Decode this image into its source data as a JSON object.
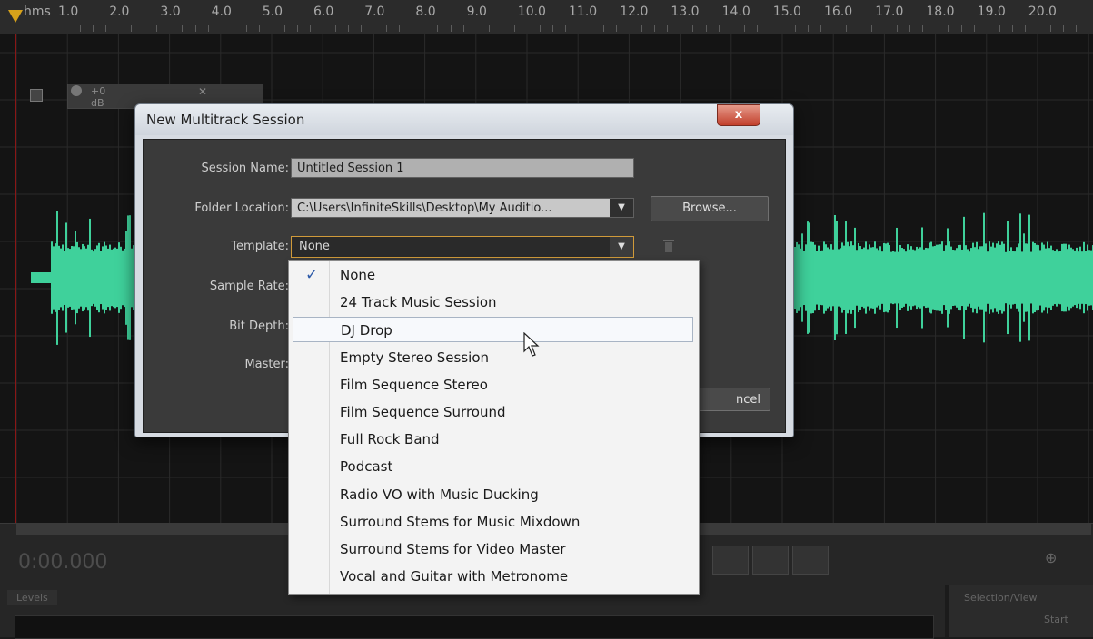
{
  "ruler": {
    "unit": "hms",
    "labels": [
      "1.0",
      "2.0",
      "3.0",
      "4.0",
      "5.0",
      "6.0",
      "7.0",
      "8.0",
      "9.0",
      "10.0",
      "11.0",
      "12.0",
      "13.0",
      "14.0",
      "15.0",
      "16.0",
      "17.0",
      "18.0",
      "19.0",
      "20.0"
    ]
  },
  "track": {
    "volume": "+0 dB"
  },
  "transport": {
    "timecode": "0:00.000"
  },
  "panels": {
    "levels_tab": "Levels",
    "selection_title": "Selection/View",
    "selection_start": "Start"
  },
  "dialog": {
    "title": "New Multitrack Session",
    "close": "x",
    "labels": {
      "session_name": "Session Name:",
      "folder_location": "Folder Location:",
      "template": "Template:",
      "sample_rate": "Sample Rate:",
      "bit_depth": "Bit Depth:",
      "master": "Master:"
    },
    "session_name": "Untitled Session 1",
    "folder_location": "C:\\Users\\InfiniteSkills\\Desktop\\My Auditio...",
    "template": "None",
    "browse_label": "Browse...",
    "cancel_label": "ncel"
  },
  "template_list": {
    "checked": "None",
    "hovered": "DJ Drop",
    "items": [
      "None",
      "24 Track Music Session",
      "DJ Drop",
      "Empty Stereo Session",
      "Film Sequence Stereo",
      "Film Sequence Surround",
      "Full Rock Band",
      "Podcast",
      "Radio VO with Music Ducking",
      "Surround Stems for Music Mixdown",
      "Surround Stems for Video Master",
      "Vocal and Guitar with Metronome"
    ]
  },
  "colors": {
    "waveform": "#3fd19b",
    "playhead": "#8a1616",
    "accent": "#d09a3a"
  }
}
